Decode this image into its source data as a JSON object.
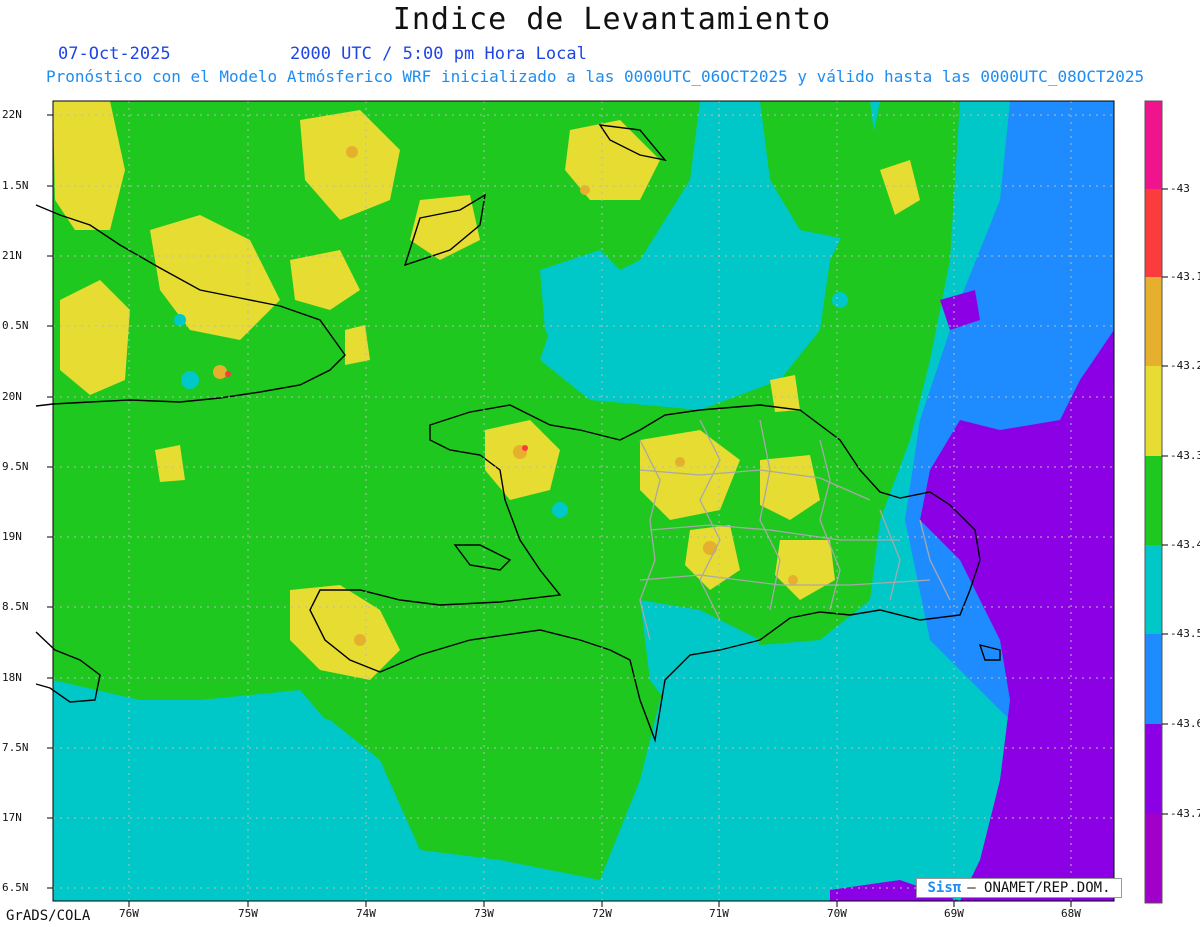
{
  "header": {
    "title": "Indice de Levantamiento",
    "date": "07-Oct-2025",
    "time": "2000 UTC / 5:00 pm Hora Local",
    "description": "Pronóstico con el Modelo Atmósferico WRF inicializado a las 0000UTC_06OCT2025 y válido hasta las  0000UTC_08OCT2025"
  },
  "map": {
    "lat_labels": [
      "22N",
      "1.5N",
      "21N",
      "0.5N",
      "20N",
      "9.5N",
      "19N",
      "8.5N",
      "18N",
      "7.5N",
      "17N",
      "6.5N"
    ],
    "lon_labels": [
      "76W",
      "75W",
      "74W",
      "73W",
      "72W",
      "71W",
      "70W",
      "69W",
      "68W"
    ]
  },
  "colorbar": {
    "labels": [
      "-43",
      "-43.1",
      "-43.2",
      "-43.3",
      "-43.4",
      "-43.5",
      "-43.6",
      "-43.7"
    ],
    "colors": [
      "#f0148c",
      "#fa3c3c",
      "#e6af2d",
      "#e6dc32",
      "#1ec81e",
      "#00c8c8",
      "#1e8cff",
      "#8c00e6",
      "#a000c8"
    ]
  },
  "palette": {
    "blue": "#1e8cff",
    "cyan": "#00c8c8",
    "green": "#1ec81e",
    "yellow": "#e6dc32",
    "orange": "#e6af2d",
    "red": "#fa3c3c",
    "purple": "#8c00e6"
  },
  "footer": {
    "software": "GrADS/COLA",
    "credit_logo": "Sisπ",
    "credit_text": "– ONAMET/REP.DOM."
  }
}
